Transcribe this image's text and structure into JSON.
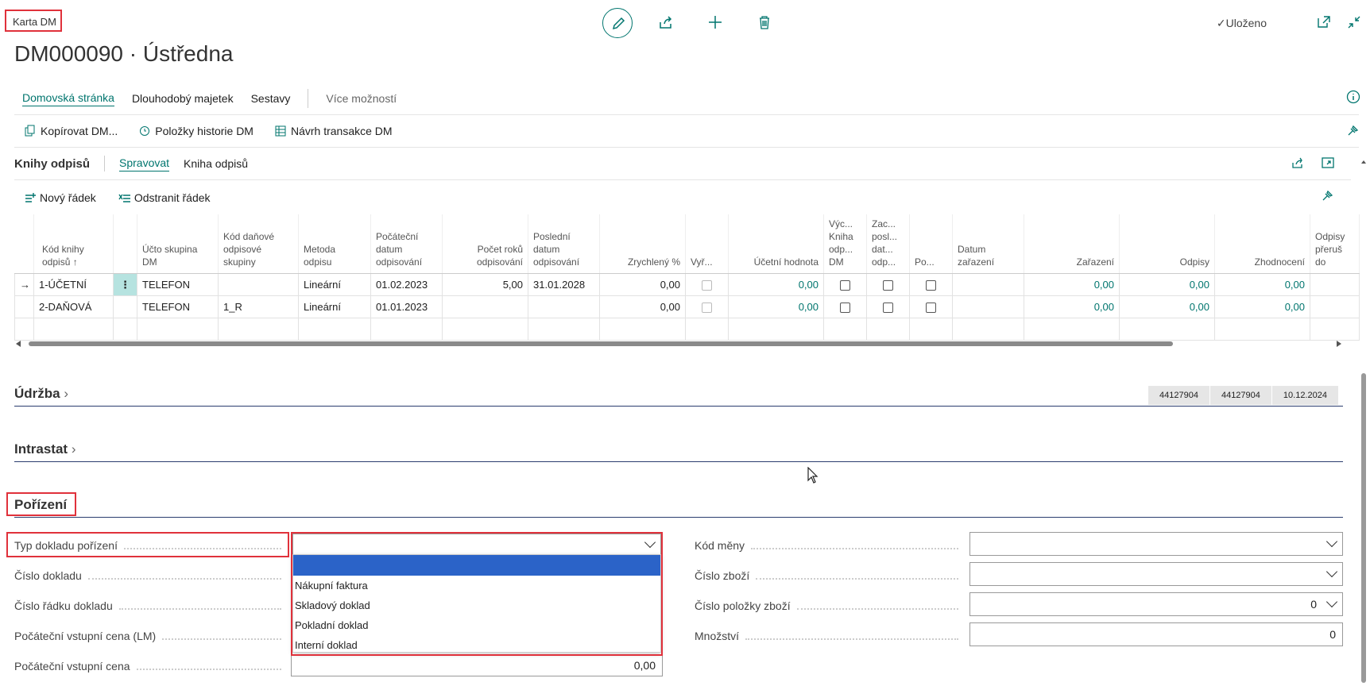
{
  "header": {
    "page_label": "Karta DM",
    "title": "DM000090 · Ústředna",
    "saved": "✓Uloženo"
  },
  "nav": {
    "tabs": [
      "Domovská stránka",
      "Dlouhodobý majetek",
      "Sestavy"
    ],
    "more": "Více možností"
  },
  "actions": {
    "copy": "Kopírovat DM...",
    "history": "Položky historie DM",
    "proposal": "Návrh transakce DM"
  },
  "subpage": {
    "title": "Knihy odpisů",
    "tab_manage": "Spravovat",
    "tab_book": "Kniha odpisů",
    "new_row": "Nový řádek",
    "delete_row": "Odstranit řádek"
  },
  "grid": {
    "headers": [
      "Kód knihy odpisů ↑",
      "Účto skupina DM",
      "Kód daňové odpisové skupiny",
      "Metoda odpisu",
      "Počáteční datum odpisování",
      "Počet roků odpisování",
      "Poslední datum odpisování",
      "Zrychlený %",
      "Vyř...",
      "Účetní hodnota",
      "Výc... Kniha odp... DM",
      "Zac... posl... dat... odp...",
      "Po...",
      "Datum zařazení",
      "Zařazení",
      "Odpisy",
      "Zhodnocení",
      "Odpisy přeruš do"
    ],
    "rows": [
      {
        "code": "1-ÚČETNÍ",
        "group": "TELEFON",
        "tax_group": "",
        "method": "Lineární",
        "start": "01.02.2023",
        "years": "5,00",
        "end": "31.01.2028",
        "accel": "0,00",
        "book_value": "0,00",
        "acq": "0,00",
        "dep": "0,00",
        "appr": "0,00"
      },
      {
        "code": "2-DAŇOVÁ",
        "group": "TELEFON",
        "tax_group": "1_R",
        "method": "Lineární",
        "start": "01.01.2023",
        "years": "",
        "end": "",
        "accel": "0,00",
        "book_value": "0,00",
        "acq": "0,00",
        "dep": "0,00",
        "appr": "0,00"
      }
    ]
  },
  "sections": {
    "maintenance": "Údržba",
    "intrastat": "Intrastat",
    "acquisition": "Pořízení"
  },
  "badges": [
    "44127904",
    "44127904",
    "10.12.2024"
  ],
  "fields_left": {
    "doc_type": "Typ dokladu pořízení",
    "doc_no": "Číslo dokladu",
    "doc_line_no": "Číslo řádku dokladu",
    "init_price_lm": "Počáteční vstupní cena (LM)",
    "init_price": "Počáteční vstupní cena",
    "init_price_value": "0,00"
  },
  "fields_right": {
    "currency": "Kód měny",
    "item_no": "Číslo zboží",
    "item_entry_no": "Číslo položky zboží",
    "item_entry_value": "0",
    "quantity": "Množství",
    "quantity_value": "0"
  },
  "dropdown_options": [
    "",
    "Nákupní faktura",
    "Skladový doklad",
    "Pokladní doklad",
    "Interní doklad"
  ]
}
